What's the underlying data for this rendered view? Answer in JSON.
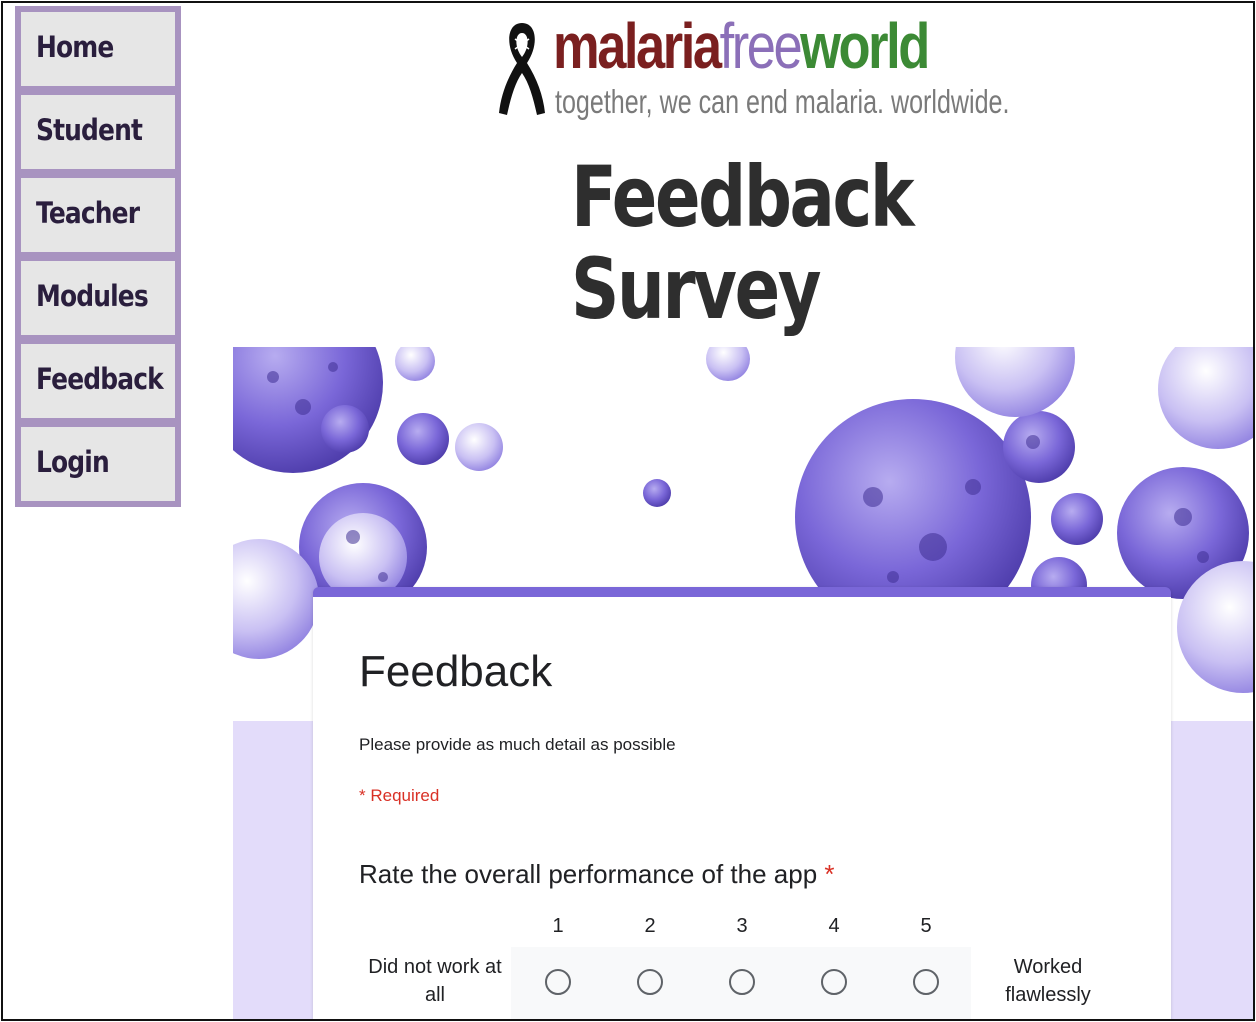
{
  "nav": {
    "items": [
      {
        "label": "Home"
      },
      {
        "label": "Student"
      },
      {
        "label": "Teacher"
      },
      {
        "label": "Modules"
      },
      {
        "label": "Feedback"
      },
      {
        "label": "Login"
      }
    ]
  },
  "logo": {
    "word1": "malaria",
    "word2": "free",
    "word3": "world",
    "tagline": "together, we can end malaria. worldwide."
  },
  "page": {
    "title_line1": "Feedback",
    "title_line2": "Survey"
  },
  "form": {
    "title": "Feedback",
    "description": "Please provide as much detail as possible",
    "required_note": "* Required",
    "question": "Rate the overall performance of the app",
    "question_star": "*",
    "scale": [
      "1",
      "2",
      "3",
      "4",
      "5"
    ],
    "low_label": "Did not work at all",
    "high_label": "Worked flawlessly"
  },
  "colors": {
    "nav_border": "#a893c0",
    "accent": "#7a67d8",
    "required": "#d93025",
    "bubble": "#7a67d8"
  }
}
